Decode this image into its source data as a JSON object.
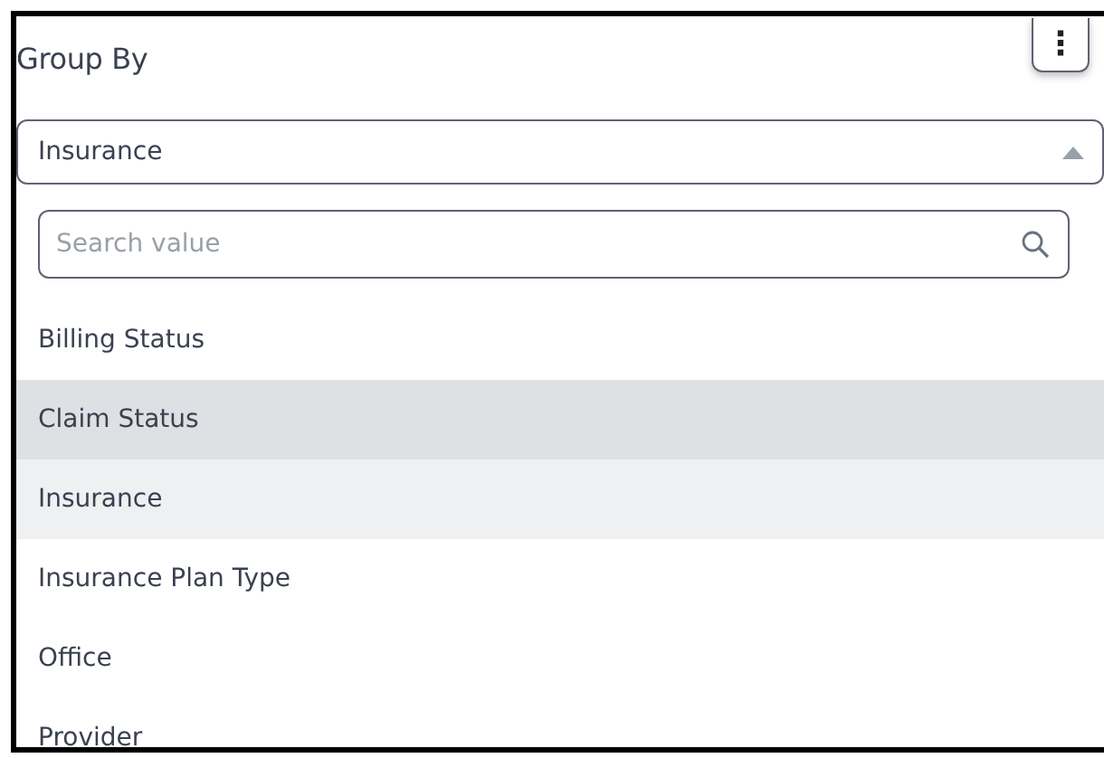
{
  "panel": {
    "title": "Group By",
    "menu_button": "⋮"
  },
  "select": {
    "value": "Insurance",
    "expanded": true
  },
  "search": {
    "placeholder": "Search value"
  },
  "options": [
    {
      "label": "Billing Status",
      "selected": false,
      "highlighted": false
    },
    {
      "label": "Claim Status",
      "selected": false,
      "highlighted": true
    },
    {
      "label": "Insurance",
      "selected": true,
      "highlighted": false
    },
    {
      "label": "Insurance Plan Type",
      "selected": false,
      "highlighted": false
    },
    {
      "label": "Office",
      "selected": false,
      "highlighted": false
    },
    {
      "label": "Provider",
      "selected": false,
      "highlighted": false
    }
  ]
}
